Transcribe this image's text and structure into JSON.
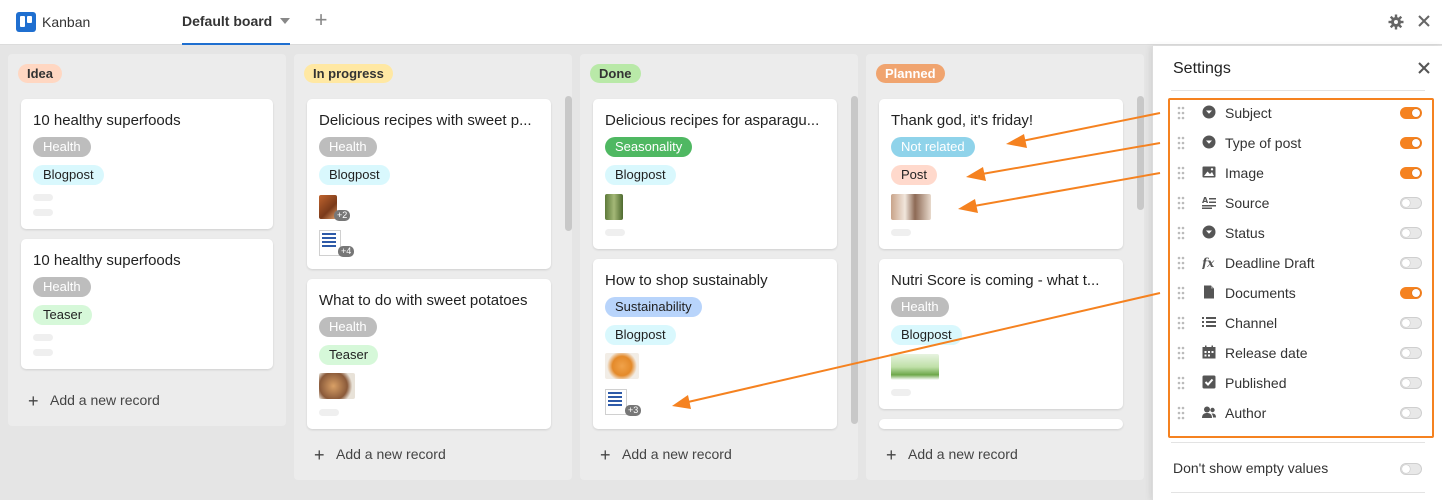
{
  "app": {
    "name": "Kanban"
  },
  "tabs": {
    "active": "Default board"
  },
  "columns": [
    {
      "label": "Idea",
      "color": "#ffd7c2",
      "cards": [
        {
          "title": "10 healthy superfoods",
          "tags": [
            "Health",
            "Blogpost"
          ]
        },
        {
          "title": "10 healthy superfoods",
          "tags": [
            "Health",
            "Teaser"
          ]
        }
      ],
      "add_label": "Add a new record"
    },
    {
      "label": "In progress",
      "color": "#ffe8a3",
      "cards": [
        {
          "title": "Delicious recipes with sweet p...",
          "tags": [
            "Health",
            "Blogpost"
          ],
          "image_extra": "+2",
          "doc_extra": "+4"
        },
        {
          "title": "What to do with sweet potatoes",
          "tags": [
            "Health",
            "Teaser"
          ]
        }
      ],
      "add_label": "Add a new record"
    },
    {
      "label": "Done",
      "color": "#b9e9a8",
      "cards": [
        {
          "title": "Delicious recipes for asparagu...",
          "tags": [
            "Seasonality",
            "Blogpost"
          ]
        },
        {
          "title": "How to shop sustainably",
          "tags": [
            "Sustainability",
            "Blogpost"
          ],
          "doc_extra": "+3"
        }
      ],
      "add_label": "Add a new record"
    },
    {
      "label": "Planned",
      "color": "#f0a46f",
      "cards": [
        {
          "title": "Thank god, it's friday!",
          "tags": [
            "Not related",
            "Post"
          ]
        },
        {
          "title": "Nutri Score is coming - what t...",
          "tags": [
            "Health",
            "Blogpost"
          ]
        }
      ],
      "add_label": "Add a new record"
    }
  ],
  "settings": {
    "title": "Settings",
    "fields": [
      {
        "label": "Subject",
        "icon": "single-select-icon",
        "enabled": true
      },
      {
        "label": "Type of post",
        "icon": "single-select-icon",
        "enabled": true
      },
      {
        "label": "Image",
        "icon": "image-icon",
        "enabled": true
      },
      {
        "label": "Source",
        "icon": "long-text-icon",
        "enabled": false
      },
      {
        "label": "Status",
        "icon": "single-select-icon",
        "enabled": false
      },
      {
        "label": "Deadline Draft",
        "icon": "formula-icon",
        "enabled": false
      },
      {
        "label": "Documents",
        "icon": "file-icon",
        "enabled": true
      },
      {
        "label": "Channel",
        "icon": "list-icon",
        "enabled": false
      },
      {
        "label": "Release date",
        "icon": "calendar-icon",
        "enabled": false
      },
      {
        "label": "Published",
        "icon": "checkbox-icon",
        "enabled": false
      },
      {
        "label": "Author",
        "icon": "users-icon",
        "enabled": false
      }
    ],
    "empty_label": "Don't show empty values",
    "empty_enabled": false
  },
  "colors": {
    "accent": "#f58220",
    "brand": "#1f6fd0"
  }
}
